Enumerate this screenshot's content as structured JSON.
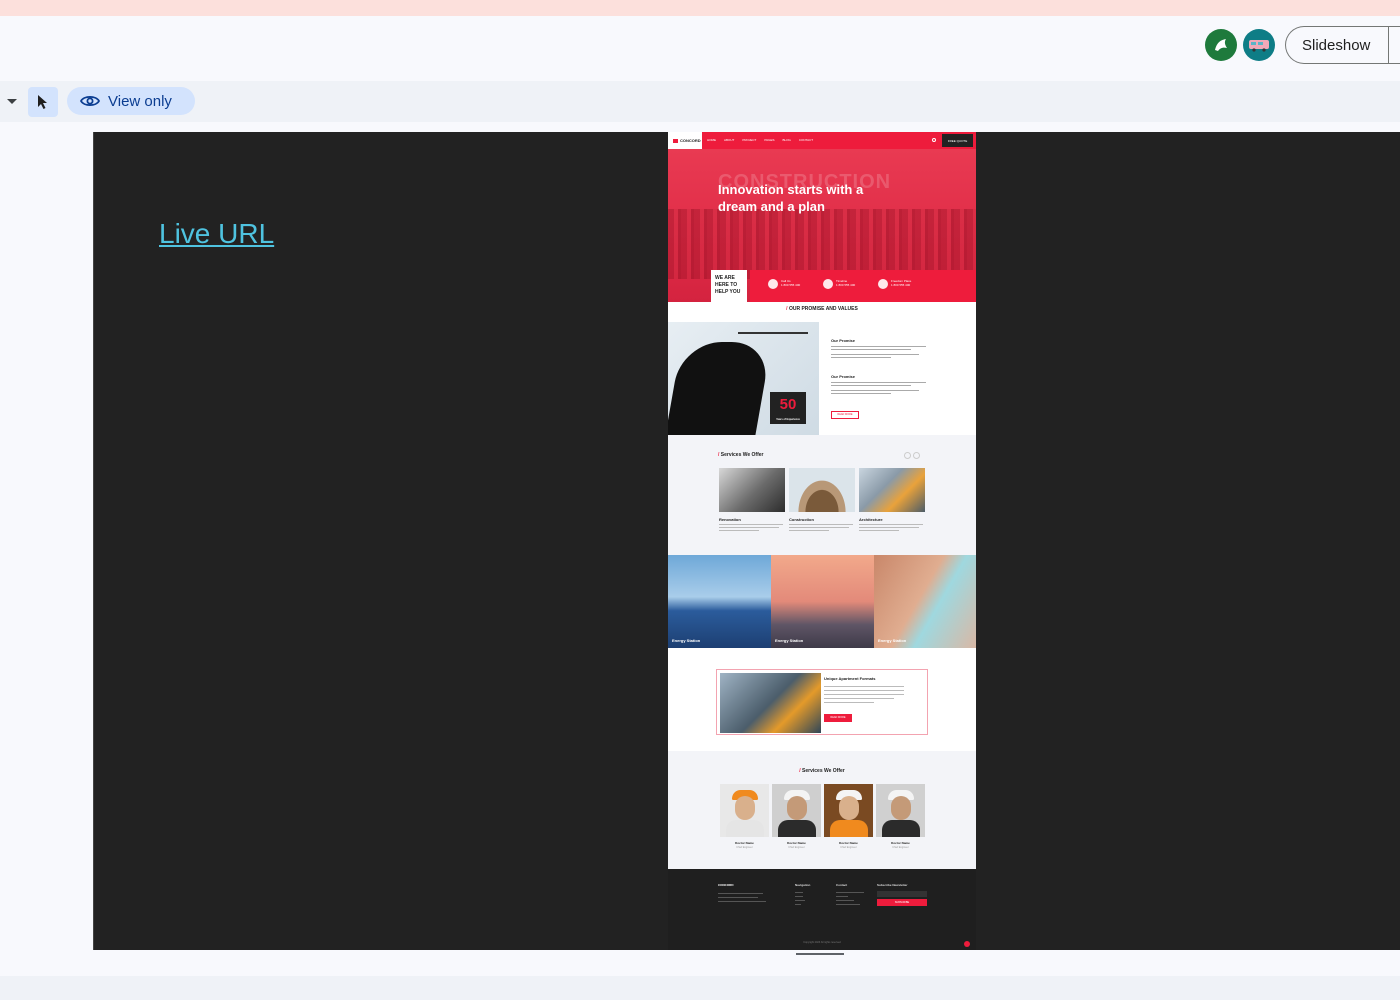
{
  "topbar": {
    "slideshow_label": "Slideshow"
  },
  "toolbar": {
    "view_only_label": "View only"
  },
  "slide": {
    "live_url_text": "Live URL"
  },
  "site": {
    "logo": "CONCORD",
    "menu": [
      "HOME",
      "ABOUT",
      "PROJECT",
      "PAGES",
      "BLOG",
      "CONTACT"
    ],
    "quote_btn": "FREE QUOTE",
    "hero_bg_word": "CONSTRUCTION",
    "hero_title": "Innovation starts with a dream and a plan",
    "help_text": "WE ARE HERE TO HELP YOU",
    "contact_items": [
      {
        "title": "Call Us",
        "line": "1 800 555 400"
      },
      {
        "title": "Timeline",
        "line": "1 800 555 400"
      },
      {
        "title": "Freedom Place",
        "line": "1 800 555 400"
      }
    ],
    "promise_heading": "OUR PROMISE AND VALUES",
    "promise_1_title": "Our Promise",
    "promise_2_title": "Our Promise",
    "fifty_number": "50",
    "fifty_caption": "Years of Experience",
    "read_more": "READ MORE",
    "services_heading": "Services We Offer",
    "services": [
      {
        "title": "Renovation"
      },
      {
        "title": "Construction"
      },
      {
        "title": "Architecture"
      }
    ],
    "gallery": [
      {
        "title": "Energy Station"
      },
      {
        "title": "Energy Station"
      },
      {
        "title": "Energy Station"
      }
    ],
    "apt_title": "Unique Apartment Formats",
    "apt_btn": "READ MORE",
    "team_heading": "Services We Offer",
    "team": [
      {
        "name": "Doctor Name",
        "role": "Chief Engineer"
      },
      {
        "name": "Doctor Name",
        "role": "Chief Engineer"
      },
      {
        "name": "Doctor Name",
        "role": "Chief Engineer"
      },
      {
        "name": "Doctor Name",
        "role": "Chief Engineer"
      }
    ],
    "footer": {
      "col_navigation": "Navigation",
      "col_contact": "Contact",
      "col_newsletter": "Subscribe Newsletter",
      "subscribe_btn": "SUBSCRIBE",
      "copyright": "Copyright 2023 All rights reserved"
    }
  },
  "colors": {
    "brand_red": "#ee1c3c",
    "link_cyan": "#4fc3e0",
    "chip_blue": "#d3e3fd"
  }
}
